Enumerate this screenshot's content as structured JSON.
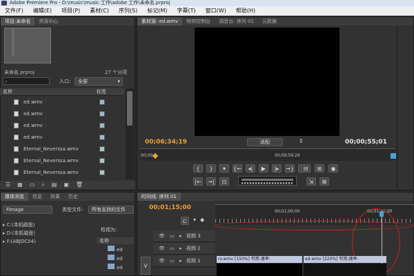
{
  "window": {
    "title": "Adobe Premiere Pro - D:\\music\\music 工作\\adobe 工作\\未命名.prproj"
  },
  "menu": [
    "文件(F)",
    "编辑(E)",
    "项目(P)",
    "素材(C)",
    "序列(S)",
    "标记(M)",
    "字幕(T)",
    "窗口(W)",
    "帮助(H)"
  ],
  "project_panel": {
    "tabs": [
      "项目:未命名",
      "资源中心"
    ],
    "project_name": "未命名.prproj",
    "item_count": "27 个分项",
    "in_label": "入口:",
    "in_value": "全部",
    "columns": [
      "名称",
      "标签"
    ],
    "files": [
      {
        "name": "ed.wmv",
        "color": "#9fb8c8"
      },
      {
        "name": "ed.wmv",
        "color": "#9fb8c8"
      },
      {
        "name": "ed.wmv",
        "color": "#9fb8c8"
      },
      {
        "name": "ed.wmv",
        "color": "#9fb8c8"
      },
      {
        "name": "Eternal_Neverssa.wmv",
        "color": "#a8c8c0"
      },
      {
        "name": "Eternal_Neverssa.wmv",
        "color": "#a8c8c0"
      },
      {
        "name": "Eternal_Neverssa.wmv",
        "color": "#a8c8c0"
      }
    ]
  },
  "bottom_left_panel": {
    "tabs": [
      "媒体浏览",
      "信息",
      "效果",
      "历史"
    ],
    "format_select": "Fimage",
    "file_type_label": "类型文件:",
    "file_type_value": "所有支持的文件",
    "tree": [
      "C:(本机磁盘)",
      "D:(本机磁盘)",
      "F:(ABJDC04)"
    ],
    "view_label": "检视为:",
    "name_col": "名称",
    "thumb_labels": [
      "ed",
      "ed",
      "ed"
    ]
  },
  "source_monitor": {
    "tabs": [
      "素材源: ed.wmv",
      "特效控制台",
      "调音台: 序列 01",
      "元数据"
    ],
    "current_time": "00;06;34;19",
    "fit_select": "适配",
    "duration": "00;00;55;01",
    "ruler_left": "00;00",
    "ruler_mid": "00;09;59;29"
  },
  "timeline": {
    "tabs": [
      "时间线: 序列 01"
    ],
    "current_time": "00;01;15;00",
    "ruler_marks": [
      "00;01;00;00",
      "00;01;15;00"
    ],
    "tracks": [
      "视频 3",
      "视频 2",
      "视频 1"
    ],
    "clips": [
      {
        "label": "ro.wmv [150%] 可用:速率:",
        "color": "#c0c8e0"
      },
      {
        "label": "ed.wmv [220%] 可用:速率:",
        "color": "#c0c8e0"
      }
    ]
  },
  "colors": {
    "accent": "#e9a23b",
    "playhead": "#4aa3d8",
    "annotation": "#d02020"
  }
}
